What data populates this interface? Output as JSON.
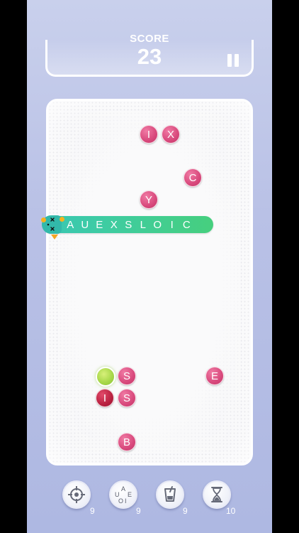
{
  "header": {
    "score_label": "SCORE",
    "score_value": "23"
  },
  "board": {
    "balls": [
      {
        "letter": "I",
        "style": "pink"
      },
      {
        "letter": "X",
        "style": "pink"
      },
      {
        "letter": "C",
        "style": "pink"
      },
      {
        "letter": "Y",
        "style": "pink"
      },
      {
        "letter": "S",
        "style": "pink"
      },
      {
        "letter": "E",
        "style": "pink"
      },
      {
        "letter": "I",
        "style": "dark"
      },
      {
        "letter": "S",
        "style": "pink"
      },
      {
        "letter": "B",
        "style": "pink"
      }
    ],
    "snake_letters": [
      "A",
      "U",
      "E",
      "X",
      "S",
      "L",
      "O",
      "I",
      "C"
    ]
  },
  "powerups": {
    "items": [
      {
        "icon": "crosshair-icon",
        "count": "9"
      },
      {
        "icon": "vowels-icon",
        "count": "9",
        "glyphs": [
          "A",
          "U",
          "E",
          "O",
          "I"
        ]
      },
      {
        "icon": "cup-icon",
        "count": "9"
      },
      {
        "icon": "hourglass-icon",
        "count": "10"
      }
    ]
  },
  "colors": {
    "ball_pink": "#d8497c",
    "ball_dark": "#b8203f",
    "snake_green": "#46cf7e",
    "snake_teal": "#39c7b4",
    "orb_green": "#a8d84a"
  }
}
